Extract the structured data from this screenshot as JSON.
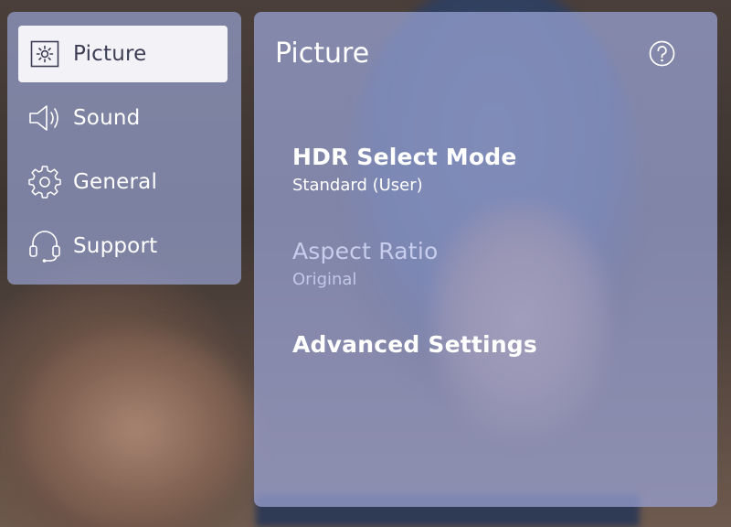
{
  "sidebar": {
    "items": [
      {
        "label": "Picture",
        "icon": "picture-icon",
        "active": true
      },
      {
        "label": "Sound",
        "icon": "speaker-icon",
        "active": false
      },
      {
        "label": "General",
        "icon": "gear-icon",
        "active": false
      },
      {
        "label": "Support",
        "icon": "headset-icon",
        "active": false
      }
    ]
  },
  "main": {
    "title": "Picture",
    "help_icon": "help-icon",
    "settings": [
      {
        "name": "HDR Select Mode",
        "value": "Standard (User)",
        "enabled": true
      },
      {
        "name": "Aspect Ratio",
        "value": "Original",
        "enabled": false
      },
      {
        "name": "Advanced Settings",
        "value": "",
        "enabled": true
      }
    ]
  },
  "colors": {
    "panel": "#9ba5d7",
    "active_item_bg": "#f3f2f7",
    "active_item_text": "#3d3d55",
    "text": "#ffffff",
    "disabled_text": "#c7cdeb"
  }
}
